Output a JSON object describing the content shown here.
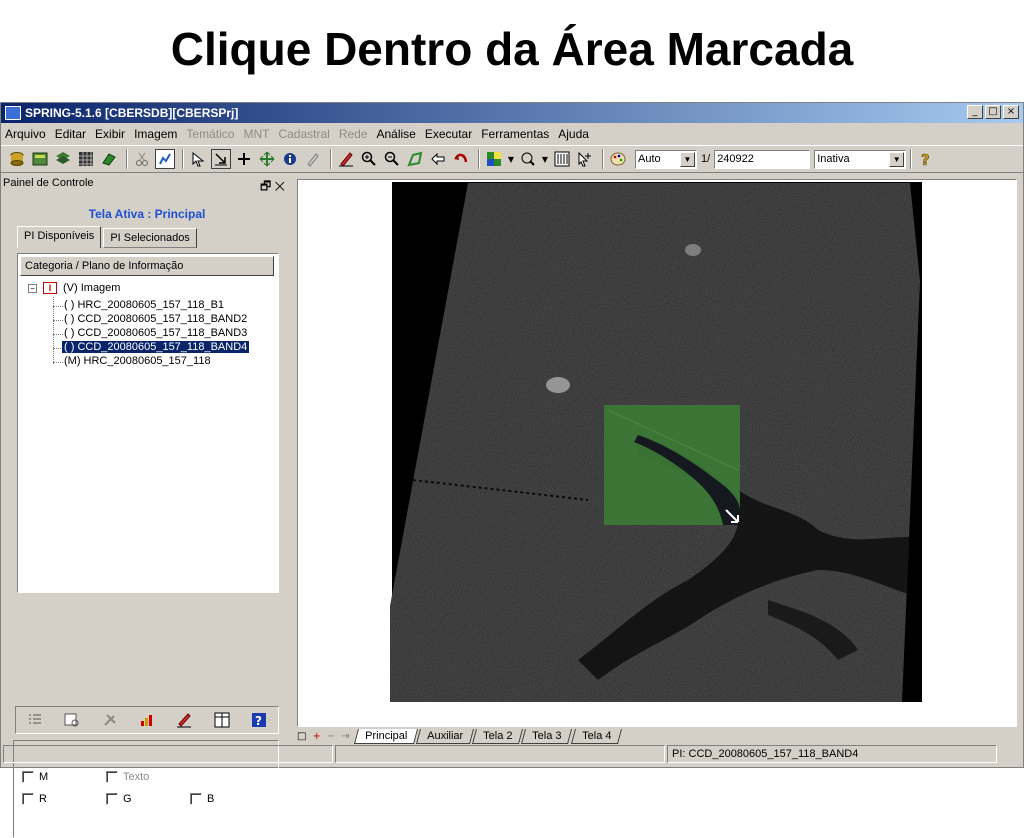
{
  "slide": {
    "title": "Clique Dentro da Área Marcada"
  },
  "window": {
    "title": "SPRING-5.1.6 [CBERSDB][CBERSPrj]",
    "controls": {
      "minimize": "_",
      "maximize": "□",
      "close": "×"
    }
  },
  "menu": {
    "items": [
      {
        "label": "Arquivo",
        "enabled": true
      },
      {
        "label": "Editar",
        "enabled": true
      },
      {
        "label": "Exibir",
        "enabled": true
      },
      {
        "label": "Imagem",
        "enabled": true
      },
      {
        "label": "Temático",
        "enabled": false
      },
      {
        "label": "MNT",
        "enabled": false
      },
      {
        "label": "Cadastral",
        "enabled": false
      },
      {
        "label": "Rede",
        "enabled": false
      },
      {
        "label": "Análise",
        "enabled": true
      },
      {
        "label": "Executar",
        "enabled": true
      },
      {
        "label": "Ferramentas",
        "enabled": true
      },
      {
        "label": "Ajuda",
        "enabled": true
      }
    ]
  },
  "toolbar": {
    "zoom_mode": "Auto",
    "scale_prefix": "1/",
    "scale_value": "240922",
    "status_select": "Inativa",
    "icons": [
      "database-icon",
      "layers-icon",
      "stack-icon",
      "grid-icon",
      "eraser-shape-icon",
      "cut-icon",
      "chart-icon",
      "pointer-icon",
      "select-icon",
      "crosshair-icon",
      "pan-icon",
      "info-icon",
      "tool-icon",
      "pencil-icon",
      "zoom-in-icon",
      "zoom-out-icon",
      "zoom-area-icon",
      "back-icon",
      "undo-icon",
      "color-icon",
      "zoom-menu-icon",
      "table-icon",
      "cursor-plus-icon",
      "palette-icon",
      "help-icon"
    ]
  },
  "control_panel": {
    "title": "Painel de Controle",
    "pin": "🗗",
    "close": "✕",
    "active_screen": "Tela Ativa : Principal",
    "tabs": [
      {
        "label": "PI Disponíveis",
        "active": true
      },
      {
        "label": "PI Selecionados",
        "active": false
      }
    ],
    "tree_header": "Categoria / Plano de Informação",
    "tree_root": {
      "expander": "−",
      "icon_letter": "I",
      "label": "(V) Imagem"
    },
    "items": [
      {
        "label": "( ) HRC_20080605_157_118_B1",
        "selected": false
      },
      {
        "label": "( ) CCD_20080605_157_118_BAND2",
        "selected": false
      },
      {
        "label": "( ) CCD_20080605_157_118_BAND3",
        "selected": false
      },
      {
        "label": "( ) CCD_20080605_157_118_BAND4",
        "selected": true
      },
      {
        "label": "(M) HRC_20080605_157_118",
        "selected": false
      }
    ],
    "bottom_tool_icons": [
      "list-icon",
      "view-icon",
      "tools-icon",
      "chart-edit-icon",
      "pencil-icon",
      "panel-icon",
      "help-icon"
    ],
    "checkboxes": {
      "m": "M",
      "texto": "Texto",
      "r": "R",
      "g": "G",
      "b": "B"
    }
  },
  "screen_tabs": {
    "controls": [
      "□",
      "+",
      "−",
      "⇥"
    ],
    "tabs": [
      {
        "label": "Principal",
        "active": true
      },
      {
        "label": "Auxiliar",
        "active": false
      },
      {
        "label": "Tela 2",
        "active": false
      },
      {
        "label": "Tela 3",
        "active": false
      },
      {
        "label": "Tela 4",
        "active": false
      }
    ]
  },
  "statusbar": {
    "pi_text": "PI: CCD_20080605_157_118_BAND4"
  },
  "colors": {
    "title_gradient_start": "#0a246a",
    "active_screen_text": "#1f4fd1",
    "highlight_area": "#3c7a35",
    "selection": "#0a246a"
  }
}
